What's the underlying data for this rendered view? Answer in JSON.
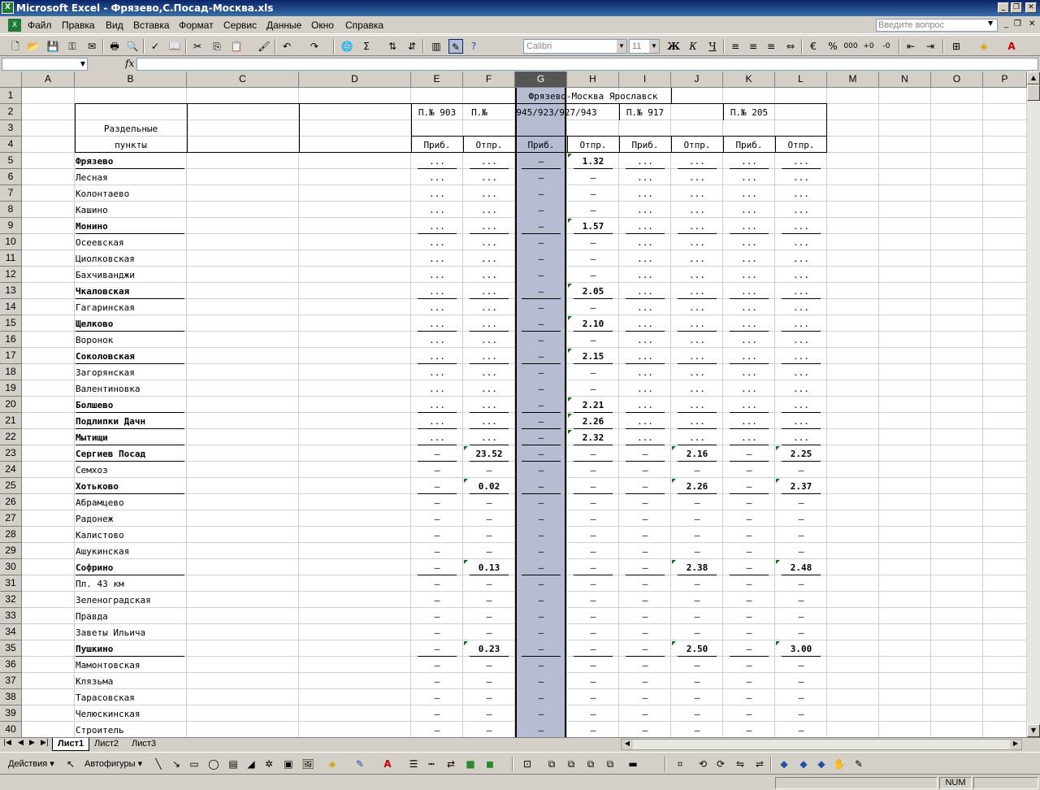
{
  "window": {
    "title": "Microsoft Excel - Фрязево,С.Посад-Москва.xls",
    "app_icon": "excel-icon"
  },
  "menu": [
    "Файл",
    "Правка",
    "Вид",
    "Вставка",
    "Формат",
    "Сервис",
    "Данные",
    "Окно",
    "Справка"
  ],
  "ask_placeholder": "Введите вопрос",
  "toolbar": {
    "font": "Calibri",
    "size": "11"
  },
  "formula_bar": {
    "name_box": "",
    "fx": "fx",
    "formula": ""
  },
  "columns": [
    "A",
    "B",
    "C",
    "D",
    "E",
    "F",
    "G",
    "H",
    "I",
    "J",
    "K",
    "L",
    "M",
    "N",
    "O",
    "P"
  ],
  "selected_column": "G",
  "header": {
    "route_title": "Фрязево-Москва Ярославск",
    "train_e": "П.№ 903",
    "train_f": "П.№",
    "train_g": "945/923/927/943",
    "train_i": "П.№ 917",
    "train_k": "П.№ 205",
    "col_b_line1": "Раздельные",
    "col_b_line2": "пункты",
    "arr": "Приб.",
    "dep": "Отпр."
  },
  "rows": [
    {
      "n": "5",
      "name": "Фрязево",
      "bold": true,
      "v": [
        "...",
        "...",
        "–",
        "1.32",
        "...",
        "...",
        "...",
        "..."
      ]
    },
    {
      "n": "6",
      "name": "Лесная",
      "bold": false,
      "v": [
        "...",
        "...",
        "–",
        "–",
        "...",
        "...",
        "...",
        "..."
      ]
    },
    {
      "n": "7",
      "name": "Колонтаево",
      "bold": false,
      "v": [
        "...",
        "...",
        "–",
        "–",
        "...",
        "...",
        "...",
        "..."
      ]
    },
    {
      "n": "8",
      "name": "Кашино",
      "bold": false,
      "v": [
        "...",
        "...",
        "–",
        "–",
        "...",
        "...",
        "...",
        "..."
      ]
    },
    {
      "n": "9",
      "name": "Монино",
      "bold": true,
      "v": [
        "...",
        "...",
        "–",
        "1.57",
        "...",
        "...",
        "...",
        "..."
      ]
    },
    {
      "n": "10",
      "name": "Осеевская",
      "bold": false,
      "v": [
        "...",
        "...",
        "–",
        "–",
        "...",
        "...",
        "...",
        "..."
      ]
    },
    {
      "n": "11",
      "name": "Циолковская",
      "bold": false,
      "v": [
        "...",
        "...",
        "–",
        "–",
        "...",
        "...",
        "...",
        "..."
      ]
    },
    {
      "n": "12",
      "name": "Бахчиванджи",
      "bold": false,
      "v": [
        "...",
        "...",
        "–",
        "–",
        "...",
        "...",
        "...",
        "..."
      ]
    },
    {
      "n": "13",
      "name": "Чкаловская",
      "bold": true,
      "v": [
        "...",
        "...",
        "–",
        "2.05",
        "...",
        "...",
        "...",
        "..."
      ]
    },
    {
      "n": "14",
      "name": "Гагаринская",
      "bold": false,
      "v": [
        "...",
        "...",
        "–",
        "–",
        "...",
        "...",
        "...",
        "..."
      ]
    },
    {
      "n": "15",
      "name": "Щелково",
      "bold": true,
      "v": [
        "...",
        "...",
        "–",
        "2.10",
        "...",
        "...",
        "...",
        "..."
      ]
    },
    {
      "n": "16",
      "name": "Воронок",
      "bold": false,
      "v": [
        "...",
        "...",
        "–",
        "–",
        "...",
        "...",
        "...",
        "..."
      ]
    },
    {
      "n": "17",
      "name": "Соколовская",
      "bold": true,
      "v": [
        "...",
        "...",
        "–",
        "2.15",
        "...",
        "...",
        "...",
        "..."
      ]
    },
    {
      "n": "18",
      "name": "Загорянская",
      "bold": false,
      "v": [
        "...",
        "...",
        "–",
        "–",
        "...",
        "...",
        "...",
        "..."
      ]
    },
    {
      "n": "19",
      "name": "Валентиновка",
      "bold": false,
      "v": [
        "...",
        "...",
        "–",
        "–",
        "...",
        "...",
        "...",
        "..."
      ]
    },
    {
      "n": "20",
      "name": "Болшево",
      "bold": true,
      "v": [
        "...",
        "...",
        "–",
        "2.21",
        "...",
        "...",
        "...",
        "..."
      ]
    },
    {
      "n": "21",
      "name": "Подлипки Дачн",
      "bold": true,
      "v": [
        "...",
        "...",
        "–",
        "2.26",
        "...",
        "...",
        "...",
        "..."
      ]
    },
    {
      "n": "22",
      "name": "Мытищи",
      "bold": true,
      "v": [
        "...",
        "...",
        "–",
        "2.32",
        "...",
        "...",
        "...",
        "..."
      ]
    },
    {
      "n": "23",
      "name": "Сергиев Посад",
      "bold": true,
      "v": [
        "–",
        "23.52",
        "–",
        "–",
        "–",
        "2.16",
        "–",
        "2.25"
      ]
    },
    {
      "n": "24",
      "name": "Семхоз",
      "bold": false,
      "v": [
        "–",
        "–",
        "–",
        "–",
        "–",
        "–",
        "–",
        "–"
      ]
    },
    {
      "n": "25",
      "name": "Хотьково",
      "bold": true,
      "v": [
        "–",
        "0.02",
        "–",
        "–",
        "–",
        "2.26",
        "–",
        "2.37"
      ]
    },
    {
      "n": "26",
      "name": "Абрамцево",
      "bold": false,
      "v": [
        "–",
        "–",
        "–",
        "–",
        "–",
        "–",
        "–",
        "–"
      ]
    },
    {
      "n": "27",
      "name": "Радонеж",
      "bold": false,
      "v": [
        "–",
        "–",
        "–",
        "–",
        "–",
        "–",
        "–",
        "–"
      ]
    },
    {
      "n": "28",
      "name": "Калистово",
      "bold": false,
      "v": [
        "–",
        "–",
        "–",
        "–",
        "–",
        "–",
        "–",
        "–"
      ]
    },
    {
      "n": "29",
      "name": "Ашукинская",
      "bold": false,
      "v": [
        "–",
        "–",
        "–",
        "–",
        "–",
        "–",
        "–",
        "–"
      ]
    },
    {
      "n": "30",
      "name": "Софрино",
      "bold": true,
      "v": [
        "–",
        "0.13",
        "–",
        "–",
        "–",
        "2.38",
        "–",
        "2.48"
      ]
    },
    {
      "n": "31",
      "name": "Пл. 43 км",
      "bold": false,
      "v": [
        "–",
        "–",
        "–",
        "–",
        "–",
        "–",
        "–",
        "–"
      ]
    },
    {
      "n": "32",
      "name": "Зеленоградская",
      "bold": false,
      "v": [
        "–",
        "–",
        "–",
        "–",
        "–",
        "–",
        "–",
        "–"
      ]
    },
    {
      "n": "33",
      "name": "Правда",
      "bold": false,
      "v": [
        "–",
        "–",
        "–",
        "–",
        "–",
        "–",
        "–",
        "–"
      ]
    },
    {
      "n": "34",
      "name": "Заветы Ильича",
      "bold": false,
      "v": [
        "–",
        "–",
        "–",
        "–",
        "–",
        "–",
        "–",
        "–"
      ]
    },
    {
      "n": "35",
      "name": "Пушкино",
      "bold": true,
      "v": [
        "–",
        "0.23",
        "–",
        "–",
        "–",
        "2.50",
        "–",
        "3.00"
      ]
    },
    {
      "n": "36",
      "name": "Мамонтовская",
      "bold": false,
      "v": [
        "–",
        "–",
        "–",
        "–",
        "–",
        "–",
        "–",
        "–"
      ]
    },
    {
      "n": "37",
      "name": "Клязьма",
      "bold": false,
      "v": [
        "–",
        "–",
        "–",
        "–",
        "–",
        "–",
        "–",
        "–"
      ]
    },
    {
      "n": "38",
      "name": "Тарасовская",
      "bold": false,
      "v": [
        "–",
        "–",
        "–",
        "–",
        "–",
        "–",
        "–",
        "–"
      ]
    },
    {
      "n": "39",
      "name": "Челюскинская",
      "bold": false,
      "v": [
        "–",
        "–",
        "–",
        "–",
        "–",
        "–",
        "–",
        "–"
      ]
    },
    {
      "n": "40",
      "name": "Строитель",
      "bold": false,
      "v": [
        "–",
        "–",
        "–",
        "–",
        "–",
        "–",
        "–",
        "–"
      ]
    }
  ],
  "row_numbers_top": [
    "1",
    "2",
    "3",
    "4"
  ],
  "sheets": [
    "Лист1",
    "Лист2",
    "Лист3"
  ],
  "drawing": {
    "actions": "Действия",
    "autoshapes": "Автофигуры"
  },
  "status": {
    "num": "NUM"
  }
}
